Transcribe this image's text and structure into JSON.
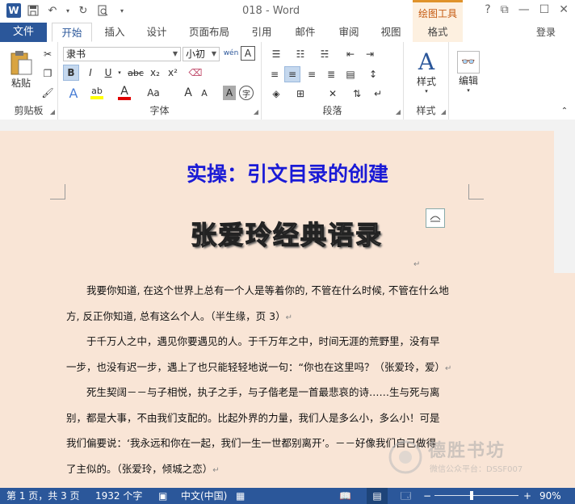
{
  "titlebar": {
    "app_icon": "W",
    "doc_title": "018 - Word",
    "context_tool": "绘图工具",
    "controls": [
      "?",
      "⧉",
      "—",
      "☐",
      "✕"
    ]
  },
  "tabs": {
    "file": "文件",
    "items": [
      "开始",
      "插入",
      "设计",
      "页面布局",
      "引用",
      "邮件",
      "审阅",
      "视图",
      "格式"
    ],
    "login": "登录"
  },
  "ribbon": {
    "clipboard": {
      "label": "剪贴板",
      "paste": "粘贴"
    },
    "font": {
      "label": "字体",
      "font_name": "隶书",
      "font_size": "小初",
      "bold": "B",
      "italic": "I",
      "underline": "U",
      "strike": "abc",
      "sub": "x₂",
      "sup": "x²",
      "grow": "A",
      "shrink": "A",
      "case": "Aa",
      "phonetic": "wén",
      "border_char": "A",
      "highlight_char": "ab",
      "font_color_char": "A",
      "shade_char": "A",
      "circle_char": "字"
    },
    "paragraph": {
      "label": "段落"
    },
    "styles": {
      "label": "样式",
      "button": "样式"
    },
    "editing": {
      "button": "编辑"
    },
    "colors": {
      "accent": "#2b579a",
      "highlight": "#ffff00",
      "font_color": "#e00000"
    }
  },
  "document": {
    "title": "实操：引文目录的创建",
    "art_text": "张爱玲经典语录",
    "paragraph_mark": "↵",
    "paragraphs": [
      {
        "lines": [
          "　　我要你知道, 在这个世界上总有一个人是等着你的, 不管在什么时候, 不管在什么地",
          "方, 反正你知道, 总有这么个人。（半生缘，页 3）"
        ]
      },
      {
        "lines": [
          "　　于千万人之中，遇见你要遇见的人。于千万年之中，时间无涯的荒野里，没有早",
          "一步，也没有迟一步，遇上了也只能轻轻地说一句：“你也在这里吗？（张爱玲，爱）"
        ]
      },
      {
        "lines": [
          "　　死生契阔－－与子相悦，执子之手，与子偕老是一首最悲哀的诗……生与死与离",
          "别，都是大事，不由我们支配的。比起外界的力量，我们人是多么小，多么小！可是",
          "我们偏要说：‘我永远和你在一起，我们一生一世都别离开’。－－好像我们自己做得",
          "了主似的。（张爱玲，倾城之恋）"
        ]
      }
    ],
    "watermark": {
      "name": "德胜书坊",
      "sub": "微信公众平台：DSSF007"
    }
  },
  "status": {
    "page": "第 1 页，共 3 页",
    "words": "1932 个字",
    "lang": "中文(中国)",
    "zoom": "90%",
    "zoom_level": 0.9,
    "minus": "−",
    "plus": "+"
  }
}
